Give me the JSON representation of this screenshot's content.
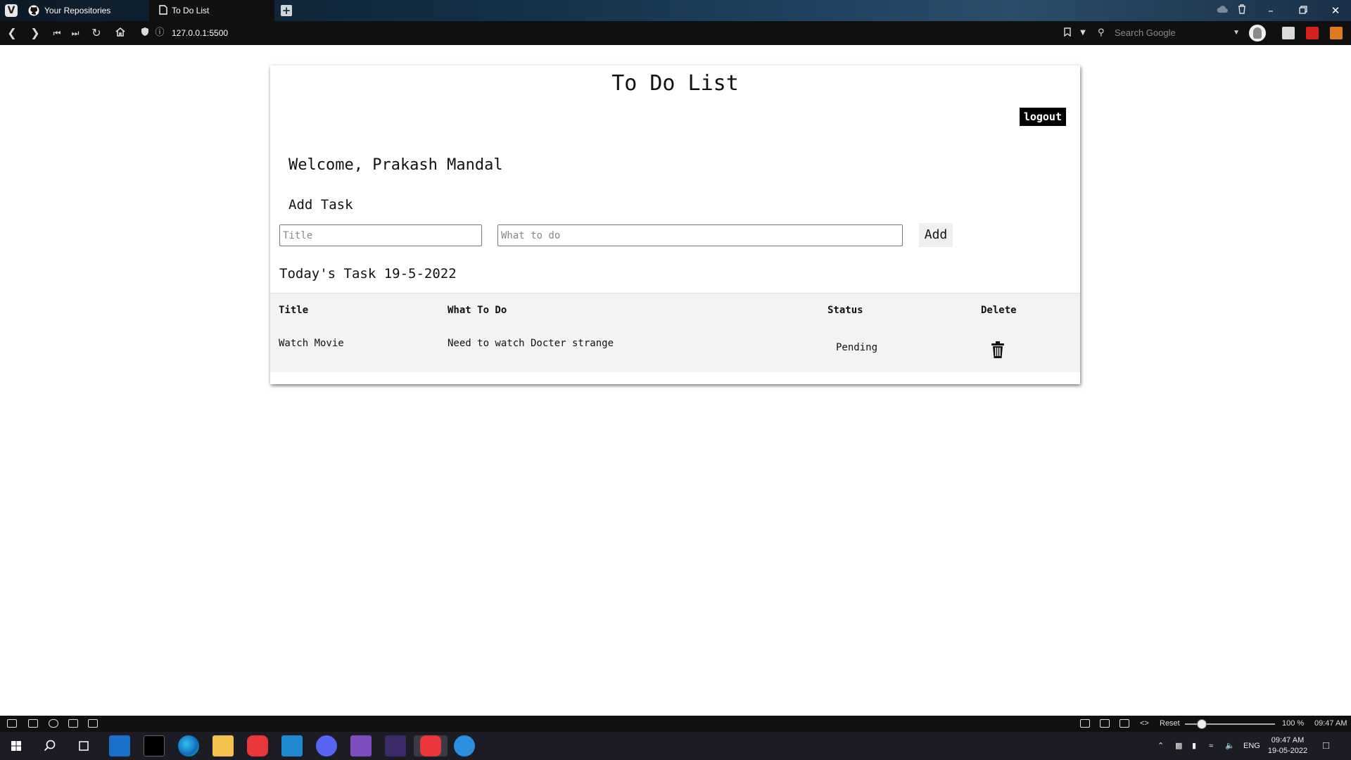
{
  "browser": {
    "tabs": [
      {
        "label": "Your Repositories",
        "icon": "github-icon"
      },
      {
        "label": "To Do List",
        "icon": "document-icon"
      }
    ],
    "url": "127.0.0.1:5500",
    "search_placeholder": "Search Google"
  },
  "page": {
    "title": "To Do List",
    "logout_label": "logout",
    "welcome": "Welcome, Prakash Mandal",
    "add_task_heading": "Add Task",
    "title_placeholder": "Title",
    "todo_placeholder": "What to do",
    "add_label": "Add",
    "todays_task": "Today's Task 19-5-2022"
  },
  "table": {
    "headers": {
      "title": "Title",
      "what": "What To Do",
      "status": "Status",
      "delete": "Delete"
    },
    "rows": [
      {
        "title": "Watch Movie",
        "what": "Need to watch Docter strange",
        "status": "Pending"
      }
    ]
  },
  "statusbar": {
    "reset_label": "Reset",
    "zoom": "100 %",
    "time": "09:47 AM"
  },
  "taskbar": {
    "lang": "ENG",
    "clock_time": "09:47 AM",
    "clock_date": "19-05-2022"
  }
}
